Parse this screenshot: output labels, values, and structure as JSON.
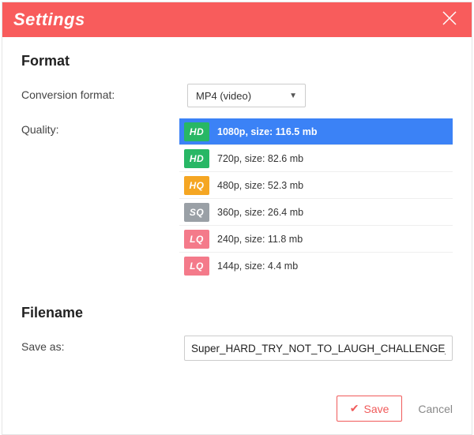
{
  "dialog": {
    "title": "Settings"
  },
  "format": {
    "heading": "Format",
    "conversion_label": "Conversion format:",
    "conversion_value": "MP4 (video)",
    "quality_label": "Quality:",
    "options": [
      {
        "badge": "HD",
        "badgeClass": "b-hd",
        "text": "1080p, size: 116.5 mb",
        "selected": true
      },
      {
        "badge": "HD",
        "badgeClass": "b-hd",
        "text": "720p, size: 82.6 mb",
        "selected": false
      },
      {
        "badge": "HQ",
        "badgeClass": "b-hq",
        "text": "480p, size: 52.3 mb",
        "selected": false
      },
      {
        "badge": "SQ",
        "badgeClass": "b-sq",
        "text": "360p, size: 26.4 mb",
        "selected": false
      },
      {
        "badge": "LQ",
        "badgeClass": "b-lq",
        "text": "240p, size: 11.8 mb",
        "selected": false
      },
      {
        "badge": "LQ",
        "badgeClass": "b-lq",
        "text": "144p, size: 4.4 mb",
        "selected": false
      }
    ]
  },
  "filename": {
    "heading": "Filename",
    "save_as_label": "Save as:",
    "value": "Super_HARD_TRY_NOT_TO_LAUGH_CHALLENGE_-_Fun"
  },
  "footer": {
    "save": "Save",
    "cancel": "Cancel"
  }
}
